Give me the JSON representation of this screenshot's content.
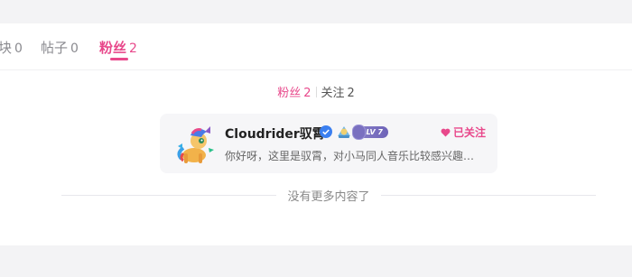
{
  "tabs": [
    {
      "label": "块",
      "count": "0",
      "active": false
    },
    {
      "label": "帖子",
      "count": "0",
      "active": false
    },
    {
      "label": "粉丝",
      "count": "2",
      "active": true
    }
  ],
  "subtabs": [
    {
      "label": "粉丝",
      "count": "2",
      "active": true
    },
    {
      "label": "关注",
      "count": "2",
      "active": false
    }
  ],
  "follower": {
    "username": "Cloudrider驭霄",
    "level": "LV 7",
    "follow_status": "已关注",
    "bio": "你好呀，这里是驭霄，对小马同人音乐比较感兴趣，欢迎来找我玩～"
  },
  "end_text": "没有更多内容了",
  "colors": {
    "accent": "#e8488b",
    "level_badge": "#7a70c0",
    "verified": "#3b7ff0"
  },
  "icons": [
    "verified-icon",
    "pony-badge-icon",
    "heart-icon",
    "avatar-pony"
  ]
}
